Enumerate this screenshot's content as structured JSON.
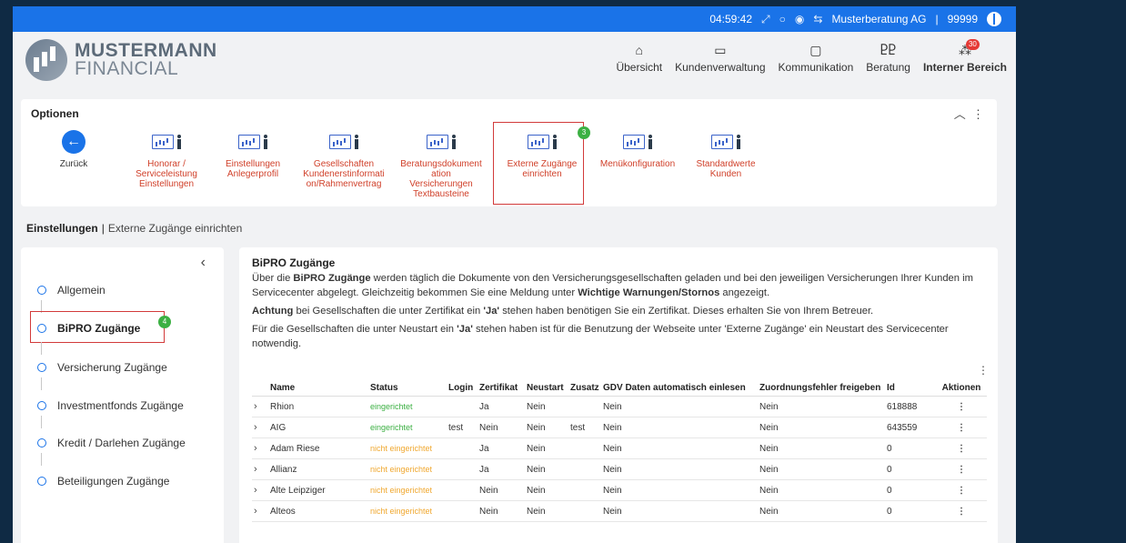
{
  "topbar": {
    "time": "04:59:42",
    "company": "Musterberatung AG",
    "separator": "|",
    "number": "99999"
  },
  "logo": {
    "line1": "MUSTERMANN",
    "line2": "FINANCIAL"
  },
  "nav": [
    {
      "label": "Übersicht",
      "icon": "home-icon"
    },
    {
      "label": "Kundenverwaltung",
      "icon": "id-card-icon"
    },
    {
      "label": "Kommunikation",
      "icon": "chat-icon"
    },
    {
      "label": "Beratung",
      "icon": "people-icon"
    },
    {
      "label": "Interner Bereich",
      "icon": "org-icon",
      "badge": "30"
    }
  ],
  "options": {
    "title": "Optionen",
    "back": "Zurück",
    "items": [
      {
        "lines": [
          "Honorar /",
          "Serviceleistung",
          "Einstellungen"
        ]
      },
      {
        "lines": [
          "Einstellungen",
          "Anlegerprofil"
        ]
      },
      {
        "lines": [
          "Gesellschaften",
          "Kundenerstinformati",
          "on/Rahmenvertrag"
        ]
      },
      {
        "lines": [
          "Beratungsdokument",
          "ation",
          "Versicherungen",
          "Textbausteine"
        ]
      },
      {
        "lines": [
          "Externe Zugänge",
          "einrichten"
        ]
      },
      {
        "lines": [
          "Menükonfiguration"
        ]
      },
      {
        "lines": [
          "Standardwerte",
          "Kunden"
        ]
      }
    ],
    "step_badge": "3"
  },
  "breadcrumb": {
    "section": "Einstellungen",
    "sep": "|",
    "current": "Externe Zugänge einrichten"
  },
  "sidebar": {
    "items": [
      "Allgemein",
      "BiPRO Zugänge",
      "Versicherung Zugänge",
      "Investmentfonds Zugänge",
      "Kredit / Darlehen Zugänge",
      "Beteiligungen Zugänge"
    ],
    "step_badge": "4"
  },
  "main": {
    "title": "BiPRO Zugänge",
    "p1": {
      "a": "Über die ",
      "b": "BiPRO Zugänge",
      "c": " werden täglich die Dokumente von den Versicherungsgesellschaften geladen und bei den jeweiligen Versicherungen Ihrer Kunden im Servicecenter abgelegt. Gleichzeitig bekommen Sie eine Meldung unter ",
      "d": "Wichtige Warnungen/Stornos",
      "e": " angezeigt."
    },
    "p2": {
      "a": "Achtung",
      "b": " bei Gesellschaften die unter Zertifikat ein ",
      "c": "'Ja'",
      "d": " stehen haben benötigen Sie ein Zertifikat. Dieses erhalten Sie von Ihrem Betreuer."
    },
    "p3": {
      "a": "Für die Gesellschaften die unter Neustart ein ",
      "b": "'Ja'",
      "c": " stehen haben ist für die Benutzung der Webseite unter 'Externe Zugänge' ein Neustart des Servicecenter notwendig."
    }
  },
  "table": {
    "headers": [
      "Name",
      "Status",
      "Login",
      "Zertifikat",
      "Neustart",
      "Zusatz",
      "GDV Daten automatisch einlesen",
      "Zuordnungsfehler freigeben",
      "Id",
      "Aktionen"
    ],
    "rows": [
      {
        "name": "Rhion",
        "status": "eingerichtet",
        "ok": true,
        "login": "",
        "zert": "Ja",
        "neu": "Nein",
        "zus": "",
        "gdv": "Nein",
        "zuo": "Nein",
        "id": "618888"
      },
      {
        "name": "AIG",
        "status": "eingerichtet",
        "ok": true,
        "login": "test",
        "zert": "Nein",
        "neu": "Nein",
        "zus": "test",
        "gdv": "Nein",
        "zuo": "Nein",
        "id": "643559"
      },
      {
        "name": "Adam Riese",
        "status": "nicht eingerichtet",
        "ok": false,
        "login": "",
        "zert": "Ja",
        "neu": "Nein",
        "zus": "",
        "gdv": "Nein",
        "zuo": "Nein",
        "id": "0"
      },
      {
        "name": "Allianz",
        "status": "nicht eingerichtet",
        "ok": false,
        "login": "",
        "zert": "Ja",
        "neu": "Nein",
        "zus": "",
        "gdv": "Nein",
        "zuo": "Nein",
        "id": "0"
      },
      {
        "name": "Alte Leipziger",
        "status": "nicht eingerichtet",
        "ok": false,
        "login": "",
        "zert": "Nein",
        "neu": "Nein",
        "zus": "",
        "gdv": "Nein",
        "zuo": "Nein",
        "id": "0"
      },
      {
        "name": "Alteos",
        "status": "nicht eingerichtet",
        "ok": false,
        "login": "",
        "zert": "Nein",
        "neu": "Nein",
        "zus": "",
        "gdv": "Nein",
        "zuo": "Nein",
        "id": "0"
      }
    ]
  },
  "colors": {
    "accent": "#1a73e8",
    "highlight": "#d23a3a",
    "step": "#3cb043",
    "status_ok": "#3cb043",
    "status_pending": "#f0a830"
  }
}
